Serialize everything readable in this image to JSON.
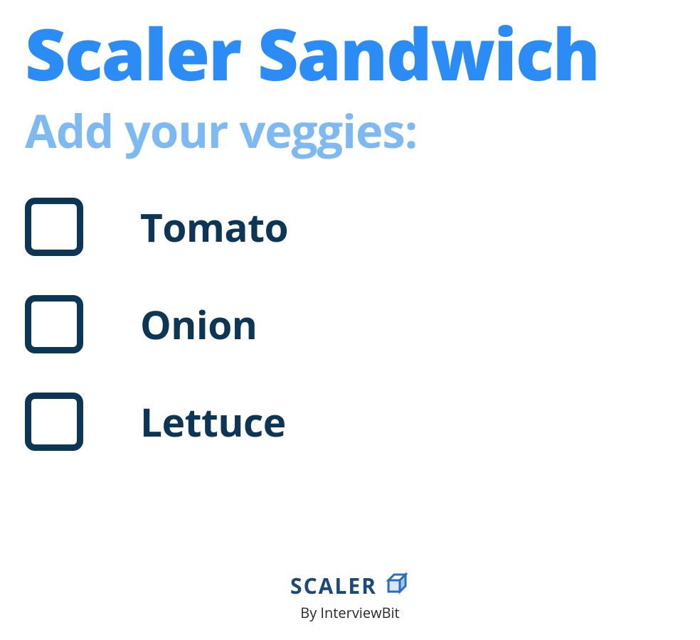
{
  "header": {
    "title": "Scaler Sandwich",
    "subtitle": "Add your veggies:"
  },
  "options": [
    {
      "label": "Tomato",
      "checked": false
    },
    {
      "label": "Onion",
      "checked": false
    },
    {
      "label": "Lettuce",
      "checked": false
    }
  ],
  "footer": {
    "brand": "SCALER",
    "byline": "By InterviewBit"
  },
  "colors": {
    "title": "#2a8cf4",
    "subtitle": "#7db9f2",
    "dark": "#0d3555"
  }
}
